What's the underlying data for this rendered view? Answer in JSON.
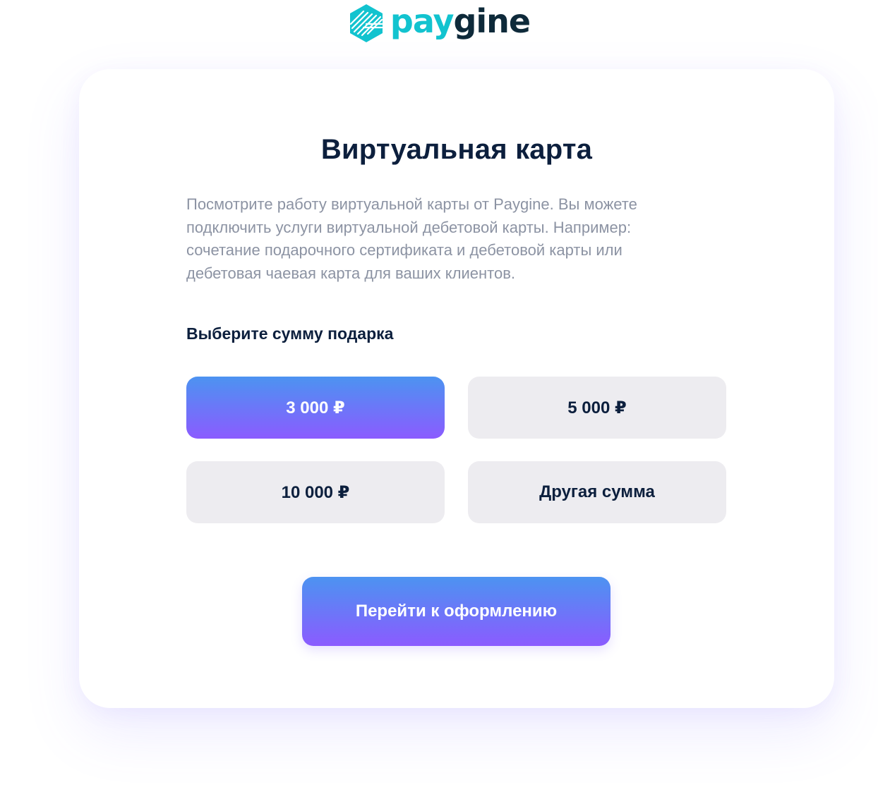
{
  "brand": {
    "name_part1": "pay",
    "name_part2": "gine",
    "icon": "hexagon-logo-icon",
    "colors": {
      "teal": "#12c3cf",
      "dark": "#0e2a3a"
    }
  },
  "card": {
    "title": "Виртуальная карта",
    "description": "Посмотрите работу виртуальной карты от Paygine. Вы можете подключить услуги виртуальной дебетовой карты. Например: сочетание подарочного сертификата и дебетовой карты или дебетовая чаевая карта для ваших клиентов.",
    "amount_label": "Выберите сумму подарка",
    "amounts": [
      {
        "label": "3 000 ₽",
        "selected": true
      },
      {
        "label": "5 000 ₽",
        "selected": false
      },
      {
        "label": "10 000 ₽",
        "selected": false
      },
      {
        "label": "Другая сумма",
        "selected": false
      }
    ],
    "cta_label": "Перейти к оформлению"
  },
  "colors": {
    "accent_gradient_top": "#4c93f1",
    "accent_gradient_bottom": "#8b5bff",
    "title_text": "#0c1f3d",
    "muted_text": "#8c93a3",
    "option_background": "#edecf0"
  }
}
